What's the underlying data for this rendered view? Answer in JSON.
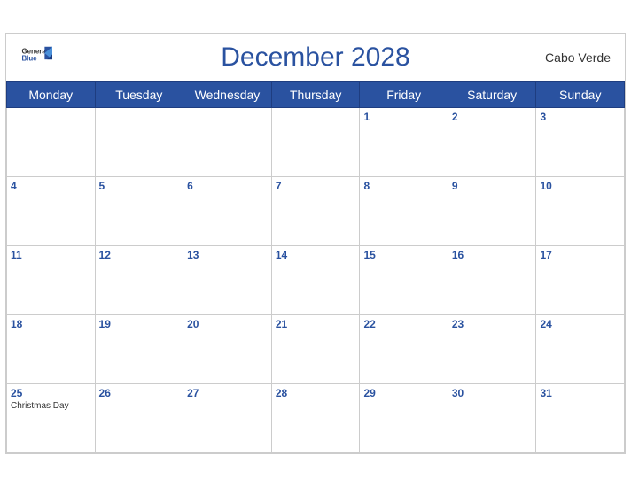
{
  "header": {
    "logo_general": "General",
    "logo_blue": "Blue",
    "month_title": "December 2028",
    "country": "Cabo Verde"
  },
  "weekdays": [
    "Monday",
    "Tuesday",
    "Wednesday",
    "Thursday",
    "Friday",
    "Saturday",
    "Sunday"
  ],
  "weeks": [
    [
      {
        "day": "",
        "empty": true
      },
      {
        "day": "",
        "empty": true
      },
      {
        "day": "",
        "empty": true
      },
      {
        "day": "",
        "empty": true
      },
      {
        "day": "1",
        "empty": false
      },
      {
        "day": "2",
        "empty": false
      },
      {
        "day": "3",
        "empty": false
      }
    ],
    [
      {
        "day": "4",
        "empty": false
      },
      {
        "day": "5",
        "empty": false
      },
      {
        "day": "6",
        "empty": false
      },
      {
        "day": "7",
        "empty": false
      },
      {
        "day": "8",
        "empty": false
      },
      {
        "day": "9",
        "empty": false
      },
      {
        "day": "10",
        "empty": false
      }
    ],
    [
      {
        "day": "11",
        "empty": false
      },
      {
        "day": "12",
        "empty": false
      },
      {
        "day": "13",
        "empty": false
      },
      {
        "day": "14",
        "empty": false
      },
      {
        "day": "15",
        "empty": false
      },
      {
        "day": "16",
        "empty": false
      },
      {
        "day": "17",
        "empty": false
      }
    ],
    [
      {
        "day": "18",
        "empty": false
      },
      {
        "day": "19",
        "empty": false
      },
      {
        "day": "20",
        "empty": false
      },
      {
        "day": "21",
        "empty": false
      },
      {
        "day": "22",
        "empty": false
      },
      {
        "day": "23",
        "empty": false
      },
      {
        "day": "24",
        "empty": false
      }
    ],
    [
      {
        "day": "25",
        "empty": false,
        "event": "Christmas Day"
      },
      {
        "day": "26",
        "empty": false
      },
      {
        "day": "27",
        "empty": false
      },
      {
        "day": "28",
        "empty": false
      },
      {
        "day": "29",
        "empty": false
      },
      {
        "day": "30",
        "empty": false
      },
      {
        "day": "31",
        "empty": false
      }
    ]
  ]
}
